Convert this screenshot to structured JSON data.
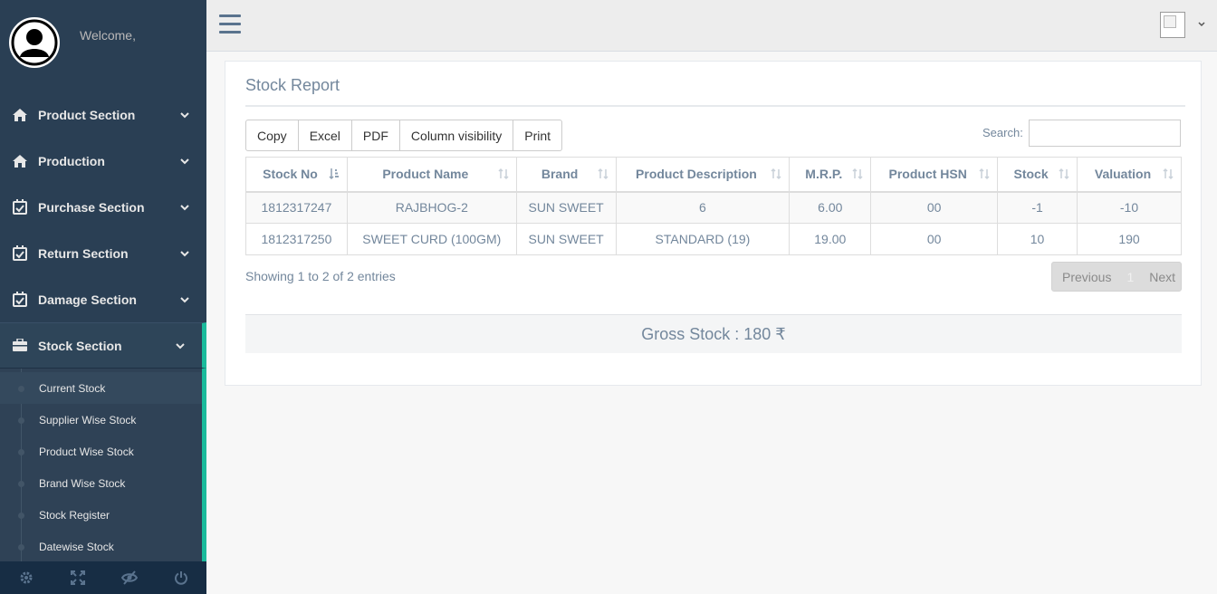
{
  "sidebar": {
    "welcome": "Welcome,",
    "menu": [
      {
        "label": "Product Section",
        "icon": "home-icon"
      },
      {
        "label": "Production",
        "icon": "home-icon"
      },
      {
        "label": "Purchase Section",
        "icon": "calendar-check-icon"
      },
      {
        "label": "Return Section",
        "icon": "calendar-check-icon"
      },
      {
        "label": "Damage Section",
        "icon": "calendar-check-icon"
      },
      {
        "label": "Stock Section",
        "icon": "briefcase-icon"
      }
    ],
    "stock_submenu": [
      "Current Stock",
      "Supplier Wise Stock",
      "Product Wise Stock",
      "Brand Wise Stock",
      "Stock Register",
      "Datewise Stock"
    ],
    "footer_icons": [
      "settings-icon",
      "fullscreen-icon",
      "lock-icon",
      "power-icon"
    ]
  },
  "colors": {
    "sidebar_bg": "#2A3F54",
    "accent": "#1ABB9C",
    "text": "#73879C"
  },
  "panel": {
    "title": "Stock Report",
    "buttons": [
      "Copy",
      "Excel",
      "PDF",
      "Column visibility",
      "Print"
    ],
    "search_label": "Search:",
    "search_value": ""
  },
  "table": {
    "headers": [
      "Stock No",
      "Product Name",
      "Brand",
      "Product Description",
      "M.R.P.",
      "Product HSN",
      "Stock",
      "Valuation"
    ],
    "rows": [
      [
        "1812317247",
        "RAJBHOG-2",
        "SUN SWEET",
        "6",
        "6.00",
        "00",
        "-1",
        "-10"
      ],
      [
        "1812317250",
        "SWEET CURD (100GM)",
        "SUN SWEET",
        "STANDARD (19)",
        "19.00",
        "00",
        "10",
        "190"
      ]
    ]
  },
  "info": "Showing 1 to 2 of 2 entries",
  "pagination": {
    "previous": "Previous",
    "page": "1",
    "next": "Next"
  },
  "gross_stock": "Gross Stock : 180 ₹"
}
